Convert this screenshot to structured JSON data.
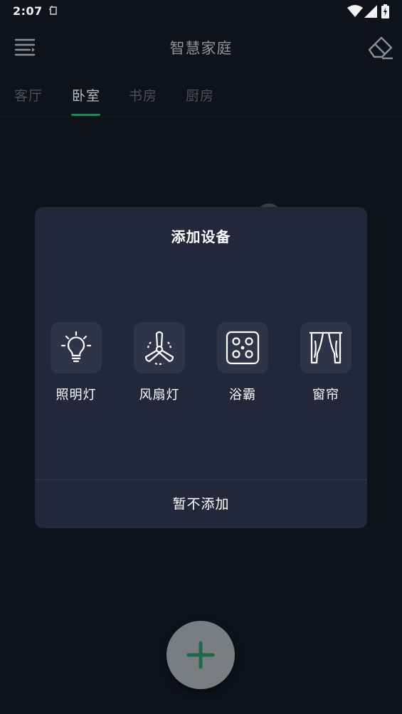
{
  "status_bar": {
    "time": "2:07",
    "icons": [
      "notification-icon",
      "wifi-icon",
      "signal-icon",
      "battery-icon"
    ]
  },
  "app_bar": {
    "title": "智慧家庭",
    "left_icon": "menu-icon",
    "right_icon": "eraser-icon"
  },
  "tabs": [
    {
      "label": "客厅",
      "active": false
    },
    {
      "label": "卧室",
      "active": true
    },
    {
      "label": "书房",
      "active": false
    },
    {
      "label": "厨房",
      "active": false
    }
  ],
  "dialog": {
    "title": "添加设备",
    "devices": [
      {
        "label": "照明灯",
        "icon": "light-bulb-icon"
      },
      {
        "label": "风扇灯",
        "icon": "fan-icon"
      },
      {
        "label": "浴霸",
        "icon": "bath-heater-icon"
      },
      {
        "label": "窗帘",
        "icon": "curtain-icon"
      }
    ],
    "cancel_label": "暂不添加"
  },
  "fab": {
    "icon": "plus-icon"
  },
  "colors": {
    "background": "#0f121a",
    "dialog": "#22273a",
    "icon_tile": "#2f3549",
    "accent": "#2e7d5b",
    "fab": "#7a7d82",
    "fab_icon": "#1f6b47"
  }
}
